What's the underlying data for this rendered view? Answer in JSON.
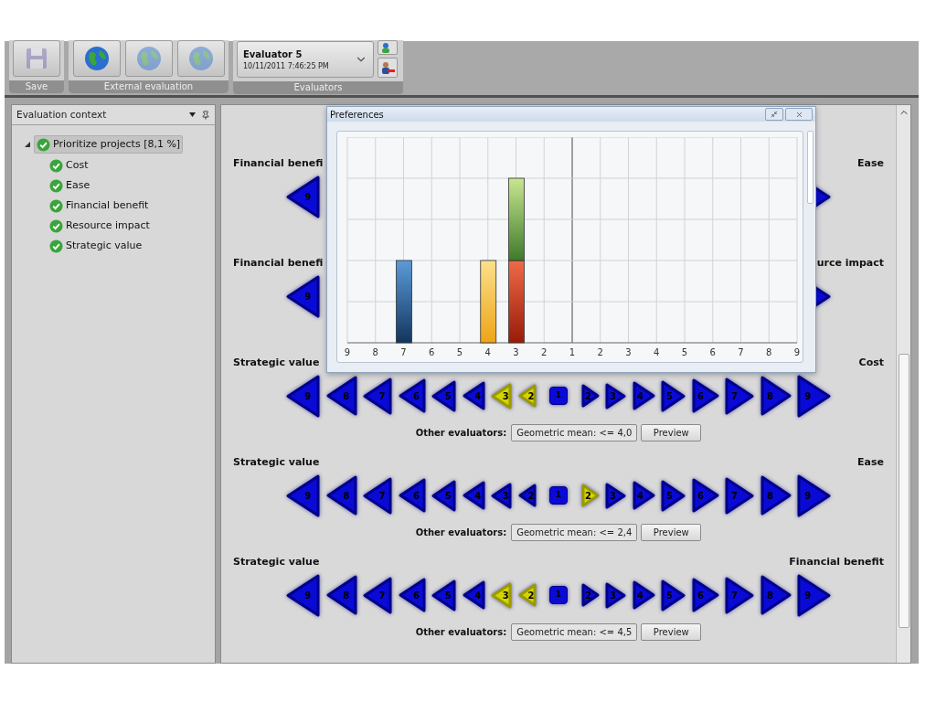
{
  "toolbar": {
    "save_group": {
      "label": "Save",
      "disabled": true
    },
    "external_group": {
      "label": "External evaluation",
      "buttons": [
        {
          "disabled": false
        },
        {
          "disabled": true
        },
        {
          "disabled": true
        }
      ]
    },
    "evaluators_group": {
      "label": "Evaluators",
      "name": "Evaluator 5",
      "date": "10/11/2011 7:46:25 PM"
    }
  },
  "side_panel": {
    "title": "Evaluation context",
    "tree": [
      {
        "label": "Prioritize projects [8,1 %]",
        "expanded": true,
        "selected": true,
        "children": [
          {
            "label": "Cost",
            "selected": false
          },
          {
            "label": "Ease",
            "selected": false
          },
          {
            "label": "Financial benefit",
            "selected": false
          },
          {
            "label": "Resource impact",
            "selected": false
          },
          {
            "label": "Strategic value",
            "selected": false
          }
        ]
      }
    ]
  },
  "comparisons": [
    {
      "left": "Financial benefi",
      "right": "Ease",
      "scale": [
        {
          "label": "9",
          "kind": "left_arrow",
          "selected": false
        },
        {
          "kind": "right_arrow",
          "selected": false
        }
      ]
    },
    {
      "left": "Financial benefi",
      "right": "urce impact",
      "scale": [
        {
          "label": "9",
          "kind": "left_arrow",
          "selected": false
        },
        {
          "kind": "right_arrow",
          "selected": false
        }
      ]
    },
    {
      "left": "Strategic value",
      "right": "Cost",
      "other_label": "Other evaluators:",
      "other_value": "Geometric mean: <= 4,0",
      "preview": "Preview",
      "scale": [
        {
          "label": "9",
          "kind": "left_arrow",
          "selected": false
        },
        {
          "label": "8",
          "kind": "left_arrow",
          "selected": false
        },
        {
          "label": "7",
          "kind": "left_arrow",
          "selected": false
        },
        {
          "label": "6",
          "kind": "left_arrow",
          "selected": false
        },
        {
          "label": "5",
          "kind": "left_arrow",
          "selected": false
        },
        {
          "label": "4",
          "kind": "left_arrow",
          "selected": false
        },
        {
          "label": "3",
          "kind": "left_arrow",
          "selected": true
        },
        {
          "label": "2",
          "kind": "left_arrow",
          "selected": true
        },
        {
          "label": "1",
          "kind": "square",
          "selected": false
        },
        {
          "label": "2",
          "kind": "right_arrow",
          "selected": false
        },
        {
          "label": "3",
          "kind": "right_arrow",
          "selected": false
        },
        {
          "label": "4",
          "kind": "right_arrow",
          "selected": false
        },
        {
          "label": "5",
          "kind": "right_arrow",
          "selected": false
        },
        {
          "label": "6",
          "kind": "right_arrow",
          "selected": false
        },
        {
          "label": "7",
          "kind": "right_arrow",
          "selected": false
        },
        {
          "label": "8",
          "kind": "right_arrow",
          "selected": false
        },
        {
          "label": "9",
          "kind": "right_arrow",
          "selected": false
        }
      ]
    },
    {
      "left": "Strategic value",
      "right": "Ease",
      "other_label": "Other evaluators:",
      "other_value": "Geometric mean: <= 2,4",
      "preview": "Preview",
      "scale": [
        {
          "label": "9",
          "kind": "left_arrow",
          "selected": false
        },
        {
          "label": "8",
          "kind": "left_arrow",
          "selected": false
        },
        {
          "label": "7",
          "kind": "left_arrow",
          "selected": false
        },
        {
          "label": "6",
          "kind": "left_arrow",
          "selected": false
        },
        {
          "label": "5",
          "kind": "left_arrow",
          "selected": false
        },
        {
          "label": "4",
          "kind": "left_arrow",
          "selected": false
        },
        {
          "label": "3",
          "kind": "left_arrow",
          "selected": false
        },
        {
          "label": "2",
          "kind": "left_arrow",
          "selected": false
        },
        {
          "label": "1",
          "kind": "square",
          "selected": false
        },
        {
          "label": "2",
          "kind": "right_arrow",
          "selected": true
        },
        {
          "label": "3",
          "kind": "right_arrow",
          "selected": false
        },
        {
          "label": "4",
          "kind": "right_arrow",
          "selected": false
        },
        {
          "label": "5",
          "kind": "right_arrow",
          "selected": false
        },
        {
          "label": "6",
          "kind": "right_arrow",
          "selected": false
        },
        {
          "label": "7",
          "kind": "right_arrow",
          "selected": false
        },
        {
          "label": "8",
          "kind": "right_arrow",
          "selected": false
        },
        {
          "label": "9",
          "kind": "right_arrow",
          "selected": false
        }
      ]
    },
    {
      "left": "Strategic value",
      "right": "Financial benefit",
      "other_label": "Other evaluators:",
      "other_value": "Geometric mean: <= 4,5",
      "preview": "Preview",
      "scale": [
        {
          "label": "9",
          "kind": "left_arrow",
          "selected": false
        },
        {
          "label": "8",
          "kind": "left_arrow",
          "selected": false
        },
        {
          "label": "7",
          "kind": "left_arrow",
          "selected": false
        },
        {
          "label": "6",
          "kind": "left_arrow",
          "selected": false
        },
        {
          "label": "5",
          "kind": "left_arrow",
          "selected": false
        },
        {
          "label": "4",
          "kind": "left_arrow",
          "selected": false
        },
        {
          "label": "3",
          "kind": "left_arrow",
          "selected": true
        },
        {
          "label": "2",
          "kind": "left_arrow",
          "selected": true
        },
        {
          "label": "1",
          "kind": "square",
          "selected": false
        },
        {
          "label": "2",
          "kind": "right_arrow",
          "selected": false
        },
        {
          "label": "3",
          "kind": "right_arrow",
          "selected": false
        },
        {
          "label": "4",
          "kind": "right_arrow",
          "selected": false
        },
        {
          "label": "5",
          "kind": "right_arrow",
          "selected": false
        },
        {
          "label": "6",
          "kind": "right_arrow",
          "selected": false
        },
        {
          "label": "7",
          "kind": "right_arrow",
          "selected": false
        },
        {
          "label": "8",
          "kind": "right_arrow",
          "selected": false
        },
        {
          "label": "9",
          "kind": "right_arrow",
          "selected": false
        }
      ]
    }
  ],
  "preferences_dialog": {
    "title": "Preferences",
    "x_axis_labels": [
      "9",
      "8",
      "7",
      "6",
      "5",
      "4",
      "3",
      "2",
      "1",
      "2",
      "3",
      "4",
      "5",
      "6",
      "7",
      "8",
      "9"
    ]
  }
}
